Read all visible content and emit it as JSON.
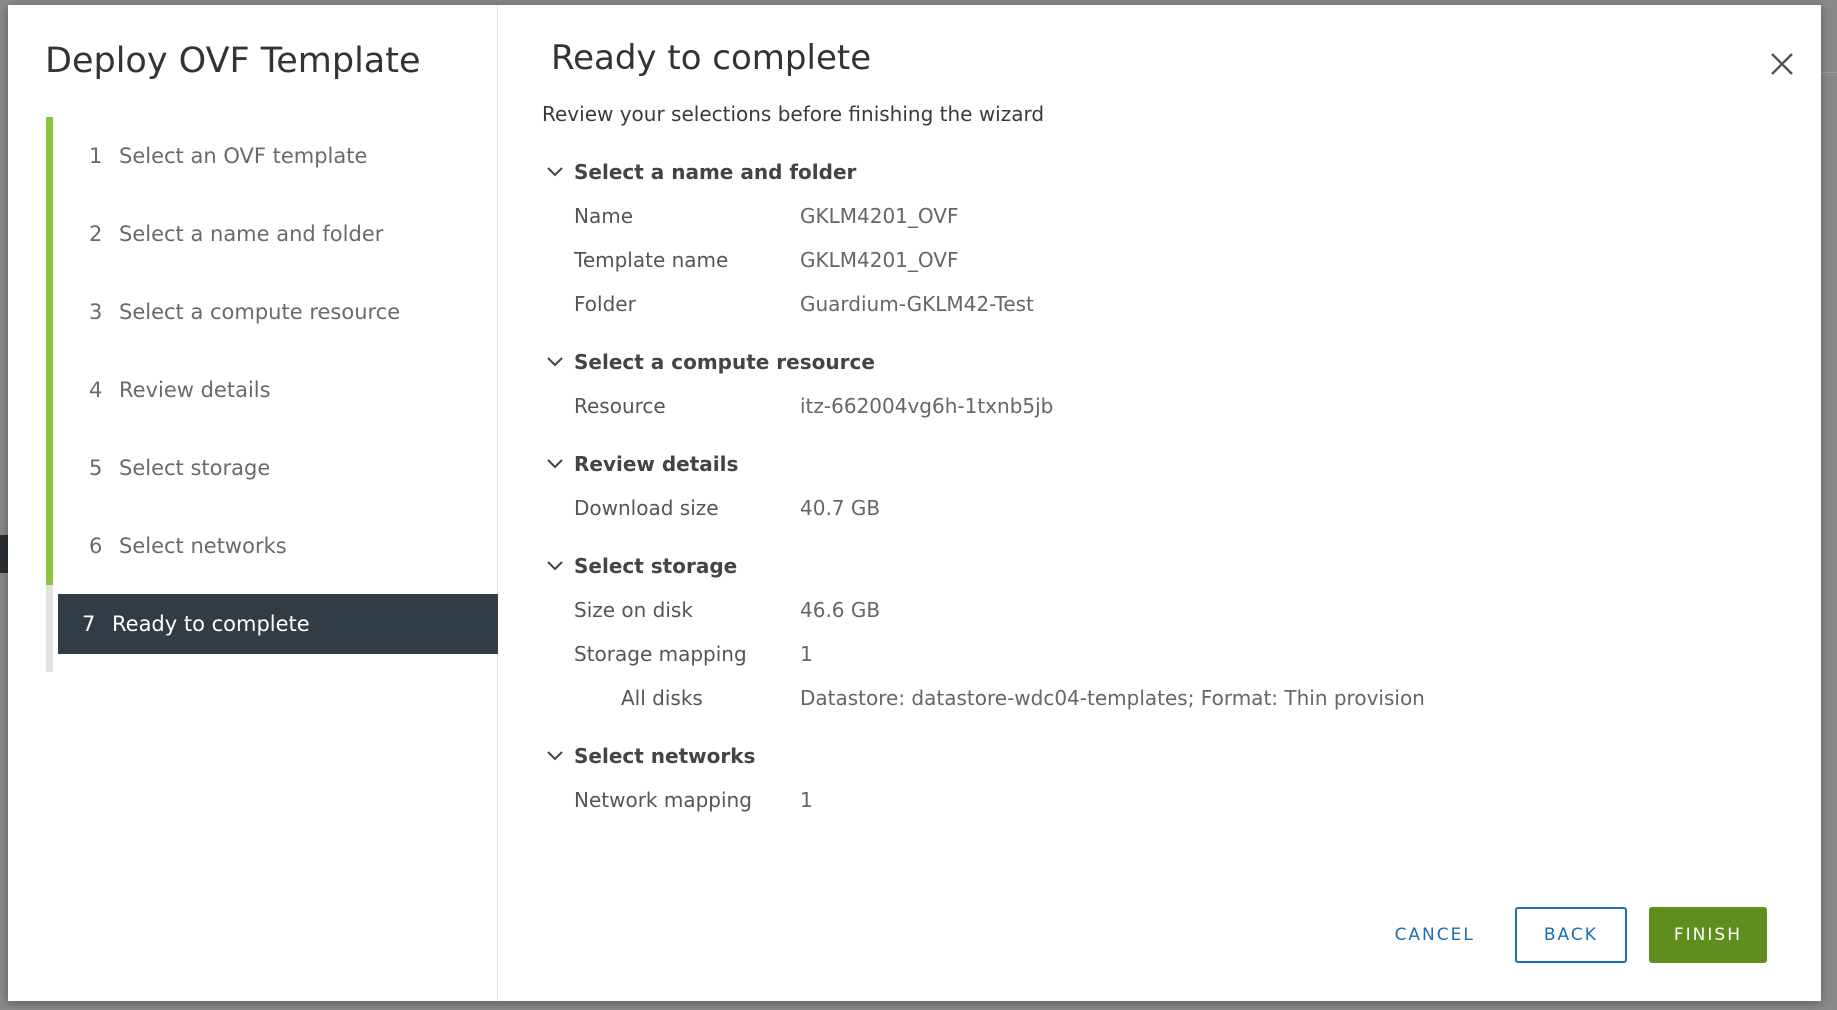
{
  "wizard": {
    "title": "Deploy OVF Template",
    "steps": [
      {
        "num": "1",
        "label": "Select an OVF template"
      },
      {
        "num": "2",
        "label": "Select a name and folder"
      },
      {
        "num": "3",
        "label": "Select a compute resource"
      },
      {
        "num": "4",
        "label": "Review details"
      },
      {
        "num": "5",
        "label": "Select storage"
      },
      {
        "num": "6",
        "label": "Select networks"
      },
      {
        "num": "7",
        "label": "Ready to complete"
      }
    ]
  },
  "page": {
    "title": "Ready to complete",
    "subtitle": "Review your selections before finishing the wizard"
  },
  "sections": {
    "name_folder": {
      "title": "Select a name and folder",
      "rows": [
        {
          "key": "Name",
          "value": "GKLM4201_OVF"
        },
        {
          "key": "Template name",
          "value": "GKLM4201_OVF"
        },
        {
          "key": "Folder",
          "value": "Guardium-GKLM42-Test"
        }
      ]
    },
    "compute": {
      "title": "Select a compute resource",
      "rows": [
        {
          "key": "Resource",
          "value": "itz-662004vg6h-1txnb5jb"
        }
      ]
    },
    "review": {
      "title": "Review details",
      "rows": [
        {
          "key": "Download size",
          "value": "40.7 GB"
        }
      ]
    },
    "storage": {
      "title": "Select storage",
      "rows": [
        {
          "key": "Size on disk",
          "value": "46.6 GB"
        },
        {
          "key": "Storage mapping",
          "value": "1"
        },
        {
          "key": "All disks",
          "value": "Datastore: datastore-wdc04-templates; Format: Thin provision"
        }
      ]
    },
    "networks": {
      "title": "Select networks",
      "rows": [
        {
          "key": "Network mapping",
          "value": "1"
        }
      ]
    }
  },
  "footer": {
    "cancel": "CANCEL",
    "back": "BACK",
    "finish": "FINISH"
  },
  "icons": {
    "close": "close-icon",
    "chevron": "chevron-down-icon"
  },
  "colors": {
    "accent_green": "#8dc43f",
    "active_step_bg": "#313c45",
    "primary_button": "#5f8d1e",
    "link_blue": "#1a6eb3"
  }
}
